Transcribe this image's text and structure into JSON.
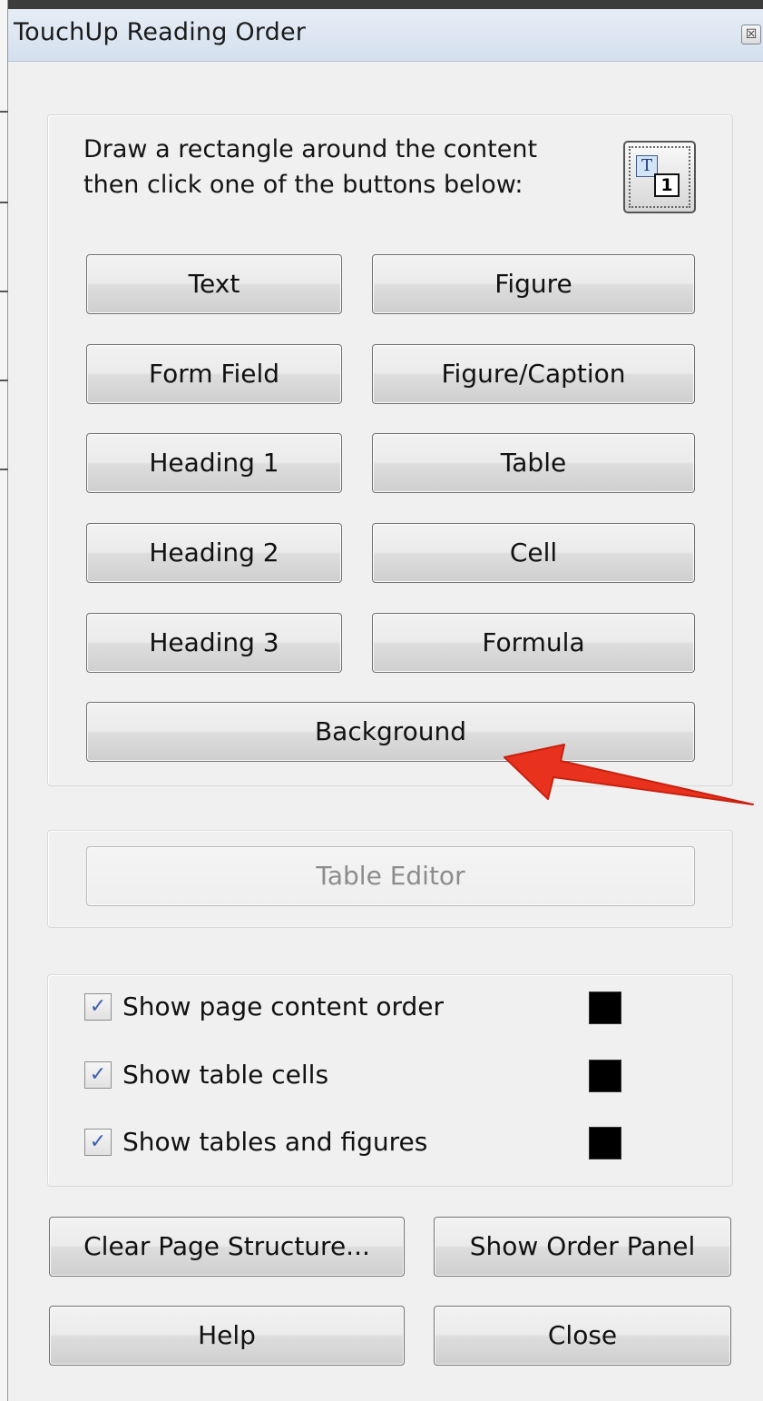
{
  "dialog": {
    "title": "TouchUp Reading Order",
    "close_glyph": "☒"
  },
  "main_group": {
    "instruction": "Draw a rectangle around the content\nthen click one of the buttons below:",
    "order_icon": {
      "t": "T",
      "number": "1"
    },
    "buttons": {
      "text": "Text",
      "figure": "Figure",
      "form_field": "Form Field",
      "figure_caption": "Figure/Caption",
      "heading1": "Heading 1",
      "table": "Table",
      "heading2": "Heading 2",
      "cell": "Cell",
      "heading3": "Heading 3",
      "formula": "Formula",
      "background": "Background"
    }
  },
  "table_group": {
    "table_editor": "Table Editor"
  },
  "options": [
    {
      "label": "Show page content order",
      "checked": true,
      "color": "#000000"
    },
    {
      "label": "Show table cells",
      "checked": true,
      "color": "#000000"
    },
    {
      "label": "Show tables and figures",
      "checked": true,
      "color": "#000000"
    }
  ],
  "check_glyph": "✓",
  "footer": {
    "clear_page_structure": "Clear Page Structure...",
    "show_order_panel": "Show Order Panel",
    "help": "Help",
    "close": "Close"
  },
  "annotation": {
    "arrow_color": "#e8321e",
    "points_to": "background-button"
  }
}
